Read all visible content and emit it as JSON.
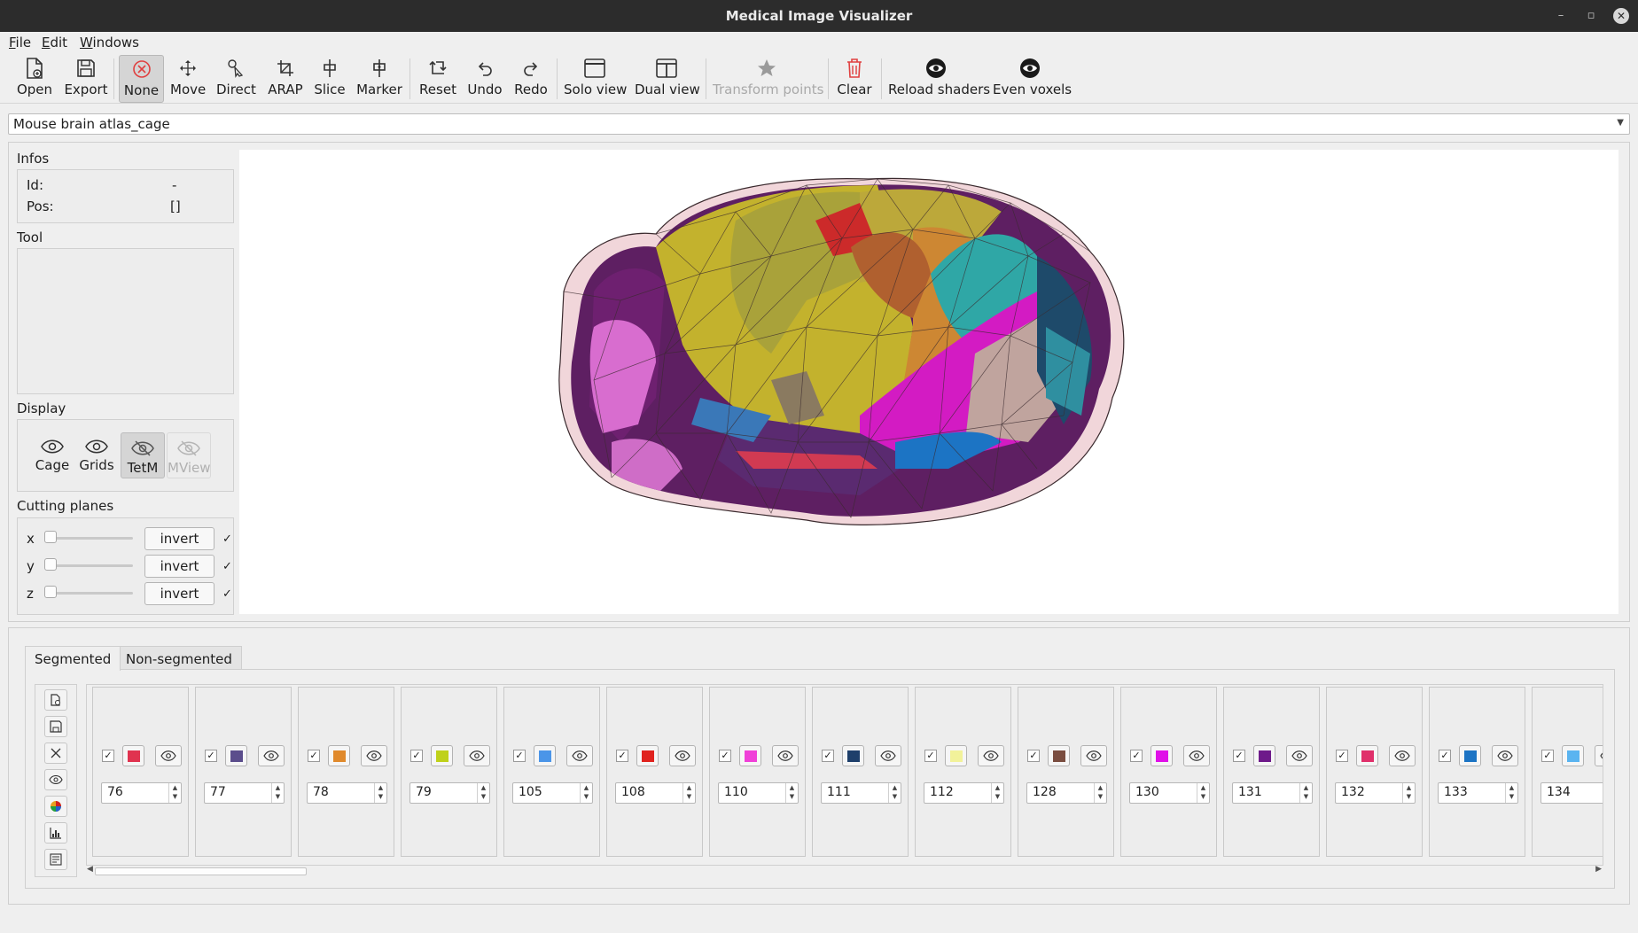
{
  "window": {
    "title": "Medical Image Visualizer",
    "minimize": "–",
    "maximize": "▫",
    "close": "✕"
  },
  "menu": [
    {
      "first": "F",
      "rest": "ile"
    },
    {
      "first": "E",
      "rest": "dit"
    },
    {
      "first": "W",
      "rest": "indows"
    }
  ],
  "toolbar": {
    "open": "Open",
    "export": "Export",
    "none": "None",
    "move": "Move",
    "direct": "Direct",
    "arap": "ARAP",
    "slice": "Slice",
    "marker": "Marker",
    "reset": "Reset",
    "undo": "Undo",
    "redo": "Redo",
    "solo_view": "Solo view",
    "dual_view": "Dual view",
    "transform_points": "Transform points",
    "clear": "Clear",
    "reload_shaders": "Reload shaders",
    "even_voxels": "Even voxels"
  },
  "selector": {
    "value": "Mouse brain atlas_cage"
  },
  "infos": {
    "title": "Infos",
    "id_label": "Id:",
    "id_value": "-",
    "pos_label": "Pos:",
    "pos_value": "[]"
  },
  "tool": {
    "title": "Tool"
  },
  "display": {
    "title": "Display",
    "cage": "Cage",
    "grids": "Grids",
    "tetm": "TetM",
    "mview": "MView"
  },
  "cutting": {
    "title": "Cutting planes",
    "rows": [
      {
        "axis": "x",
        "invert": "invert",
        "checked": "✓"
      },
      {
        "axis": "y",
        "invert": "invert",
        "checked": "✓"
      },
      {
        "axis": "z",
        "invert": "invert",
        "checked": "✓"
      }
    ]
  },
  "tabs": {
    "segmented": "Segmented",
    "non_segmented": "Non-segmented"
  },
  "segments": [
    {
      "id": "76",
      "color": "#e0334f"
    },
    {
      "id": "77",
      "color": "#5b4d8c"
    },
    {
      "id": "78",
      "color": "#e08a2c"
    },
    {
      "id": "79",
      "color": "#bfd11a"
    },
    {
      "id": "105",
      "color": "#4b95e8"
    },
    {
      "id": "108",
      "color": "#e0221e"
    },
    {
      "id": "110",
      "color": "#f040d8"
    },
    {
      "id": "111",
      "color": "#1e3f6b"
    },
    {
      "id": "112",
      "color": "#f2f29a"
    },
    {
      "id": "128",
      "color": "#7a4d40"
    },
    {
      "id": "130",
      "color": "#e010e8"
    },
    {
      "id": "131",
      "color": "#6e1a8a"
    },
    {
      "id": "132",
      "color": "#e0306b"
    },
    {
      "id": "133",
      "color": "#1c74c4"
    },
    {
      "id": "134",
      "color": "#5ab4f0"
    }
  ],
  "segment_checked": "✓"
}
